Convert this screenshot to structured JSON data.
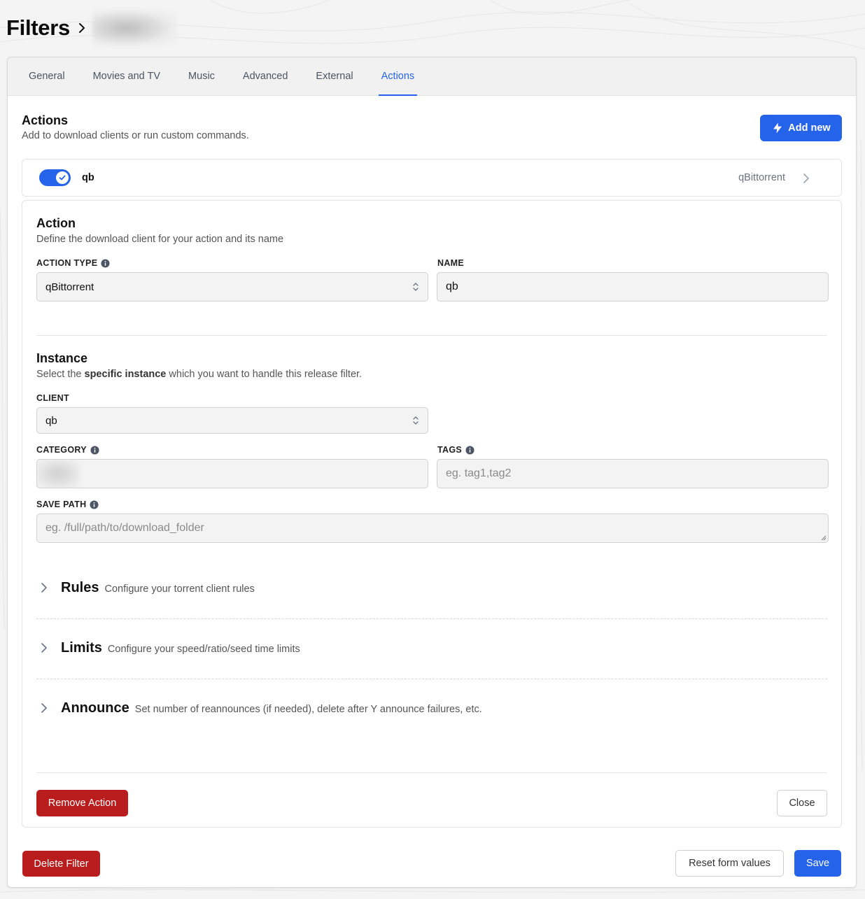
{
  "header": {
    "title": "Filters",
    "breadcrumb_chevron_icon": "chevron-right-icon"
  },
  "tabs": [
    {
      "label": "General",
      "active": false
    },
    {
      "label": "Movies and TV",
      "active": false
    },
    {
      "label": "Music",
      "active": false
    },
    {
      "label": "Advanced",
      "active": false
    },
    {
      "label": "External",
      "active": false
    },
    {
      "label": "Actions",
      "active": true
    }
  ],
  "actions_section": {
    "title": "Actions",
    "description": "Add to download clients or run custom commands.",
    "add_button": {
      "label": "Add new",
      "icon": "bolt-icon"
    }
  },
  "action_item": {
    "enabled": true,
    "name": "qb",
    "client_type": "qBittorrent"
  },
  "action_detail": {
    "title": "Action",
    "description": "Define the download client for your action and its name",
    "action_type_label": "ACTION TYPE",
    "action_type_value": "qBittorrent",
    "name_label": "NAME",
    "name_value": "qb"
  },
  "instance": {
    "title": "Instance",
    "description_pre": "Select the ",
    "description_bold": "specific instance",
    "description_post": " which you want to handle this release filter.",
    "client_label": "CLIENT",
    "client_value": "qb",
    "category_label": "CATEGORY",
    "category_value": "",
    "tags_label": "TAGS",
    "tags_placeholder": "eg. tag1,tag2",
    "save_path_label": "SAVE PATH",
    "save_path_placeholder": "eg. /full/path/to/download_folder"
  },
  "collapsibles": [
    {
      "title": "Rules",
      "description": "Configure your torrent client rules"
    },
    {
      "title": "Limits",
      "description": "Configure your speed/ratio/seed time limits"
    },
    {
      "title": "Announce",
      "description": "Set number of reannounces (if needed), delete after Y announce failures, etc."
    }
  ],
  "detail_buttons": {
    "remove": "Remove Action",
    "close": "Close"
  },
  "footer": {
    "delete": "Delete Filter",
    "reset": "Reset form values",
    "save": "Save"
  },
  "colors": {
    "accent": "#2563eb",
    "danger": "#b91c1c"
  }
}
